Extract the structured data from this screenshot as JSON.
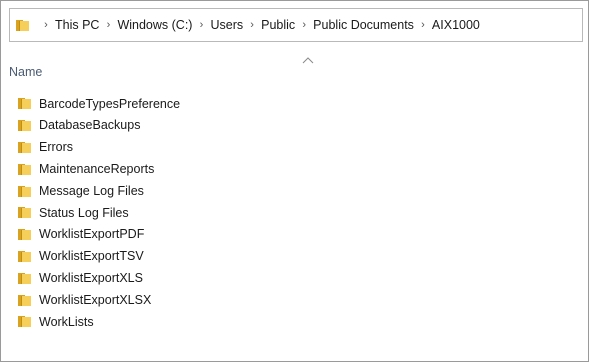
{
  "address_bar": {
    "breadcrumbs": [
      "This PC",
      "Windows (C:)",
      "Users",
      "Public",
      "Public Documents",
      "AIX1000"
    ],
    "separator": "›"
  },
  "column_header": {
    "name_label": "Name",
    "sort_indicator": "ascending"
  },
  "files": [
    {
      "name": "BarcodeTypesPreference",
      "icon": "folder-icon"
    },
    {
      "name": "DatabaseBackups",
      "icon": "folder-icon"
    },
    {
      "name": "Errors",
      "icon": "folder-icon"
    },
    {
      "name": "MaintenanceReports",
      "icon": "folder-icon"
    },
    {
      "name": "Message Log Files",
      "icon": "folder-icon"
    },
    {
      "name": "Status Log Files",
      "icon": "folder-icon"
    },
    {
      "name": "WorklistExportPDF",
      "icon": "folder-icon"
    },
    {
      "name": "WorklistExportTSV",
      "icon": "folder-icon"
    },
    {
      "name": "WorklistExportXLS",
      "icon": "folder-icon"
    },
    {
      "name": "WorklistExportXLSX",
      "icon": "folder-icon"
    },
    {
      "name": "WorkLists",
      "icon": "folder-icon"
    }
  ],
  "colors": {
    "folder_front": "#f6cf5a",
    "folder_back": "#d9a320",
    "header_text": "#4a5b73",
    "border": "#9a9a9a"
  }
}
